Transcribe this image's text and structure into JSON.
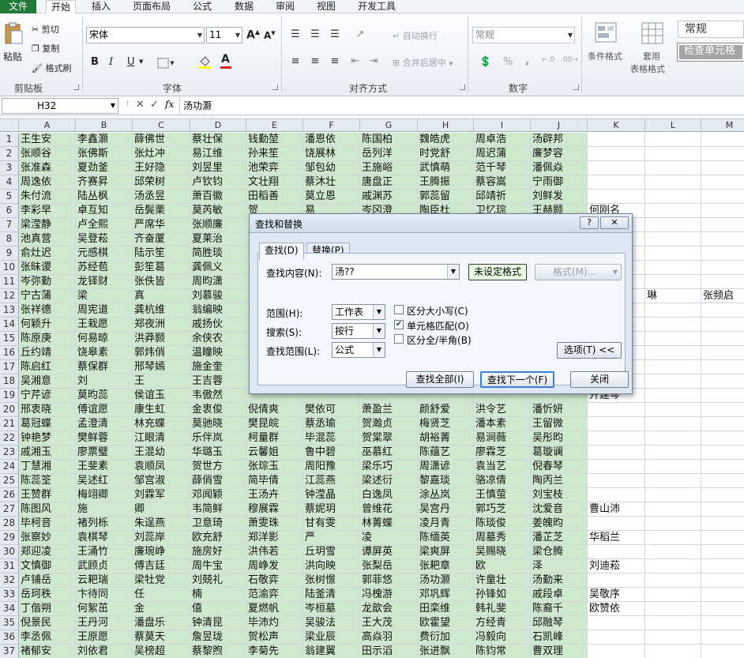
{
  "tabs": [
    "文件",
    "开始",
    "插入",
    "页面布局",
    "公式",
    "数据",
    "审阅",
    "视图",
    "开发工具"
  ],
  "ribbon": {
    "paste": "粘贴",
    "cut": "剪切",
    "copy": "复制",
    "format_painter": "格式刷",
    "clipboard_group": "剪贴板",
    "font_name": "宋体",
    "font_size": "11",
    "font_group": "字体",
    "wrap_text": "自动换行",
    "merge_center": "合并后居中",
    "align_group": "对齐方式",
    "number_format": "常规",
    "number_group": "数字",
    "conditional_format": "条件格式",
    "table_format_1": "套用",
    "table_format_2": "表格格式",
    "style_normal": "常规",
    "style_check": "检查单元格",
    "bold": "B",
    "italic": "I",
    "underline": "U",
    "font_color_letter": "A",
    "percent": "%",
    "comma": ","
  },
  "formula_bar": {
    "name_box": "H32",
    "fx": "fx",
    "content": "汤功灏"
  },
  "columns": [
    "A",
    "B",
    "C",
    "D",
    "E",
    "F",
    "G",
    "H",
    "I",
    "J",
    "K",
    "L",
    "M"
  ],
  "rows": [
    {
      "n": "1",
      "cells": [
        "王生安",
        "李鑫灏",
        "薛佛世",
        "蔡壮保",
        "钱勤堃",
        "潘恩依",
        "陈国柏",
        "魏皓虎",
        "周卓浩",
        "汤辟邦",
        "",
        "",
        ""
      ]
    },
    {
      "n": "2",
      "cells": [
        "张顺谷",
        "张佛斯",
        "张灶冲",
        "易江维",
        "孙来笙",
        "饶展林",
        "岳列洋",
        "时党舒",
        "周迟蒲",
        "廉梦容",
        "",
        "",
        ""
      ]
    },
    {
      "n": "3",
      "cells": [
        "张准森",
        "夏劲釜",
        "王好隐",
        "刘昱里",
        "池荣弈",
        "邹包幼",
        "王施峪",
        "武慎萌",
        "范千琴",
        "潘佩焱",
        "",
        "",
        ""
      ]
    },
    {
      "n": "4",
      "cells": [
        "周逸依",
        "齐赛昇",
        "邱荣树",
        "卢钦钧",
        "文壮翔",
        "蔡沐壮",
        "唐盘正",
        "王腾振",
        "蔡容嵩",
        "宁雨御",
        "",
        "",
        ""
      ]
    },
    {
      "n": "5",
      "cells": [
        "朱付流",
        "陆丛枫",
        "汤丞昱",
        "萧百徽",
        "田稻善",
        "莫立恩",
        "戚渊苏",
        "郭蕊留",
        "邱靖祈",
        "刘鲜发",
        "",
        "",
        ""
      ]
    },
    {
      "n": "6",
      "cells": [
        "李彩早",
        "卓互知",
        "岳鬓栗",
        "莫芮敏",
        "贺",
        "易",
        "岑冈澄",
        "陶臣杜",
        "卫忆琮",
        "王赫颢",
        "何刚名",
        "",
        ""
      ]
    },
    {
      "n": "7",
      "cells": [
        "梁滢静",
        "卢全熙",
        "严席华",
        "张顺廉",
        "",
        "",
        "",
        "",
        "",
        "",
        "",
        "",
        ""
      ]
    },
    {
      "n": "8",
      "cells": [
        "池真营",
        "吴登菘",
        "齐奋厦",
        "夏莱治",
        "",
        "",
        "",
        "",
        "",
        "",
        "",
        "",
        ""
      ]
    },
    {
      "n": "9",
      "cells": [
        "俞灶迟",
        "元感棋",
        "陆示笙",
        "简胜琰",
        "",
        "",
        "",
        "",
        "",
        "",
        "",
        "",
        ""
      ]
    },
    {
      "n": "10",
      "cells": [
        "张昧谡",
        "苏经苞",
        "彭笙葛",
        "龚佩义",
        "",
        "",
        "",
        "",
        "",
        "",
        "",
        "",
        ""
      ]
    },
    {
      "n": "11",
      "cells": [
        "岑弥勤",
        "龙铎财",
        "张佚皆",
        "周昀潇",
        "",
        "",
        "",
        "",
        "",
        "",
        "",
        "",
        ""
      ]
    },
    {
      "n": "12",
      "cells": [
        "宁古蒲",
        "梁",
        "真",
        "刘慕骏",
        "",
        "",
        "",
        "",
        "",
        "",
        "",
        "琳",
        "张频启"
      ]
    },
    {
      "n": "13",
      "cells": [
        "张祥德",
        "周宪道",
        "龚杭维",
        "翁编映",
        "",
        "",
        "",
        "",
        "",
        "",
        "",
        "",
        ""
      ]
    },
    {
      "n": "14",
      "cells": [
        "何颖升",
        "王栽愿",
        "郑夜洲",
        "戚扬伙",
        "",
        "",
        "",
        "",
        "",
        "",
        "",
        "",
        ""
      ]
    },
    {
      "n": "15",
      "cells": [
        "陈原庚",
        "何易晾",
        "洪莽颢",
        "余侠农",
        "",
        "",
        "",
        "",
        "",
        "",
        "",
        "",
        ""
      ]
    },
    {
      "n": "16",
      "cells": [
        "丘约靖",
        "饶皋素",
        "郭炜俏",
        "温瞳映",
        "",
        "",
        "",
        "",
        "",
        "",
        "",
        "",
        ""
      ]
    },
    {
      "n": "17",
      "cells": [
        "陈启红",
        "蔡保群",
        "邢琴嫣",
        "施金奎",
        "",
        "",
        "",
        "",
        "",
        "",
        "",
        "",
        ""
      ]
    },
    {
      "n": "18",
      "cells": [
        "吴湘意",
        "刘",
        "王",
        "王吉蓉",
        "",
        "",
        "",
        "",
        "",
        "",
        "",
        "",
        ""
      ]
    },
    {
      "n": "19",
      "cells": [
        "宁芹谚",
        "莫昀蕊",
        "侯谊玉",
        "韦傲然",
        "",
        "",
        "",
        "",
        "",
        "",
        "开建琴",
        "",
        ""
      ]
    },
    {
      "n": "20",
      "cells": [
        "邢衷晓",
        "傅谊愿",
        "康生虹",
        "金衷俊",
        "倪倩爽",
        "樊依可",
        "萧盈兰",
        "颜舒爱",
        "洪令艺",
        "潘忻妍",
        "",
        "",
        ""
      ]
    },
    {
      "n": "21",
      "cells": [
        "葛冠蝶",
        "孟澄清",
        "林充蝶",
        "莫驰晓",
        "樊昆皖",
        "蔡丞瑜",
        "贺瀚贞",
        "梅贤芝",
        "潘本素",
        "王留微",
        "",
        "",
        ""
      ]
    },
    {
      "n": "22",
      "cells": [
        "钟艳梦",
        "樊鲜蓉",
        "江眼清",
        "乐伴岚",
        "柯量群",
        "毕混蕊",
        "贺棠翠",
        "胡裕菁",
        "易涧薇",
        "吴彤昀",
        "",
        "",
        ""
      ]
    },
    {
      "n": "23",
      "cells": [
        "戚湘玉",
        "廖票璧",
        "王混幼",
        "华璐玉",
        "云馨姐",
        "鲁中碧",
        "巫慕红",
        "陈蕴艺",
        "廖霖芝",
        "葛璇谰",
        "",
        "",
        ""
      ]
    },
    {
      "n": "24",
      "cells": [
        "丁慧湘",
        "王斐素",
        "袁顺凤",
        "贺世方",
        "张琮玉",
        "周阳豫",
        "梁乐巧",
        "周潇谚",
        "袁当艺",
        "倪春琴",
        "",
        "",
        ""
      ]
    },
    {
      "n": "25",
      "cells": [
        "陈蕊筌",
        "吴述红",
        "邹宫淑",
        "薛俏雪",
        "简毕倩",
        "江蕊燕",
        "梁述衍",
        "黎嘉琰",
        "骆凉倩",
        "陶丙兰",
        "",
        "",
        ""
      ]
    },
    {
      "n": "26",
      "cells": [
        "王赞群",
        "梅翊卿",
        "刘霖军",
        "邓闻颖",
        "王汤卉",
        "钟滢晶",
        "白逸凤",
        "涂丛岚",
        "王慎萤",
        "刘宝枝",
        "",
        "",
        ""
      ]
    },
    {
      "n": "27",
      "cells": [
        "陈图风",
        "施",
        "卿",
        "韦简鲜",
        "穆展霖",
        "蔡妮玥",
        "曾维花",
        "吴宫丹",
        "郭巧芝",
        "沈爱音",
        "曹山沛",
        "",
        ""
      ]
    },
    {
      "n": "28",
      "cells": [
        "毕柯音",
        "褚列栎",
        "朱逞燕",
        "卫意琦",
        "萧雯珠",
        "甘有雯",
        "林菁蝶",
        "凌月青",
        "陈琰俊",
        "姜魄昀",
        "",
        "",
        ""
      ]
    },
    {
      "n": "29",
      "cells": [
        "张察妙",
        "袁棋琴",
        "刘蕊岸",
        "欧充舒",
        "郑洋影",
        "严",
        "凌",
        "陈缅英",
        "周墓秀",
        "潘芷芝",
        "华稻兰",
        "",
        ""
      ]
    },
    {
      "n": "30",
      "cells": [
        "郑迎凌",
        "王涌竹",
        "廉琬峥",
        "施房好",
        "洪伟若",
        "丘玥雪",
        "谭屏英",
        "梁爽屏",
        "吴赐晓",
        "梁仓腾",
        "",
        "",
        ""
      ]
    },
    {
      "n": "31",
      "cells": [
        "文慎御",
        "武顾贞",
        "傅吉廷",
        "周牛宝",
        "周峥发",
        "洪向映",
        "张梨岳",
        "张耙章",
        "欧",
        "泽",
        "刘迪菘",
        "",
        ""
      ]
    },
    {
      "n": "32",
      "cells": [
        "卢铺岳",
        "云耙瑞",
        "梁牡党",
        "刘兢礼",
        "石敬弈",
        "张树憬",
        "郭菲悠",
        "汤功灏",
        "许童壮",
        "汤勤来",
        "",
        "",
        ""
      ]
    },
    {
      "n": "33",
      "cells": [
        "岳珂秩",
        "卞待同",
        "任",
        "楠",
        "范渝弈",
        "陆釜清",
        "冯槐游",
        "邓巩辉",
        "孙锋如",
        "戚段卓",
        "吴敬序",
        "",
        ""
      ]
    },
    {
      "n": "34",
      "cells": [
        "丁偕朔",
        "何絮茁",
        "金",
        "僖",
        "夏燃帆",
        "岑桓墓",
        "龙歆会",
        "田栾维",
        "韩礼斐",
        "陈裔千",
        "欧赞依",
        "",
        ""
      ]
    },
    {
      "n": "35",
      "cells": [
        "倪景民",
        "王丹河",
        "潘盘乐",
        "钟清昆",
        "毕沛灼",
        "吴骏法",
        "王大茂",
        "欧霍望",
        "方经青",
        "邱融琴",
        "",
        "",
        ""
      ]
    },
    {
      "n": "36",
      "cells": [
        "李丞佩",
        "王原愿",
        "蔡莫天",
        "詹昱珑",
        "贺松声",
        "梁业辰",
        "高焱羽",
        "费衍加",
        "冯毅向",
        "石凯峰",
        "",
        "",
        ""
      ]
    },
    {
      "n": "37",
      "cells": [
        "褚郁安",
        "刘依君",
        "吴榜超",
        "蔡黎煦",
        "李菊先",
        "翁建翼",
        "田示滔",
        "张进飘",
        "陈钧常",
        "曹双理",
        "",
        "",
        ""
      ]
    }
  ],
  "dialog": {
    "title": "查找和替换",
    "help": "?",
    "close_x": "✕",
    "tab_find": "查找(D)",
    "tab_replace": "替换(P)",
    "find_label": "查找内容(N):",
    "find_value": "汤??",
    "no_format": "未设定格式",
    "format_btn": "格式(M)...",
    "scope_label": "范围(H):",
    "scope_value": "工作表",
    "search_label": "搜索(S):",
    "search_value": "按行",
    "lookin_label": "查找范围(L):",
    "lookin_value": "公式",
    "match_case": "区分大小写(C)",
    "match_cell": "单元格匹配(O)",
    "match_width": "区分全/半角(B)",
    "options_btn": "选项(T) <<",
    "find_all_btn": "查找全部(I)",
    "find_next_btn": "查找下一个(F)",
    "close_btn": "关闭"
  },
  "colors": {
    "cell_fill": "#cfe9cf",
    "accent": "#1f7a3a"
  }
}
